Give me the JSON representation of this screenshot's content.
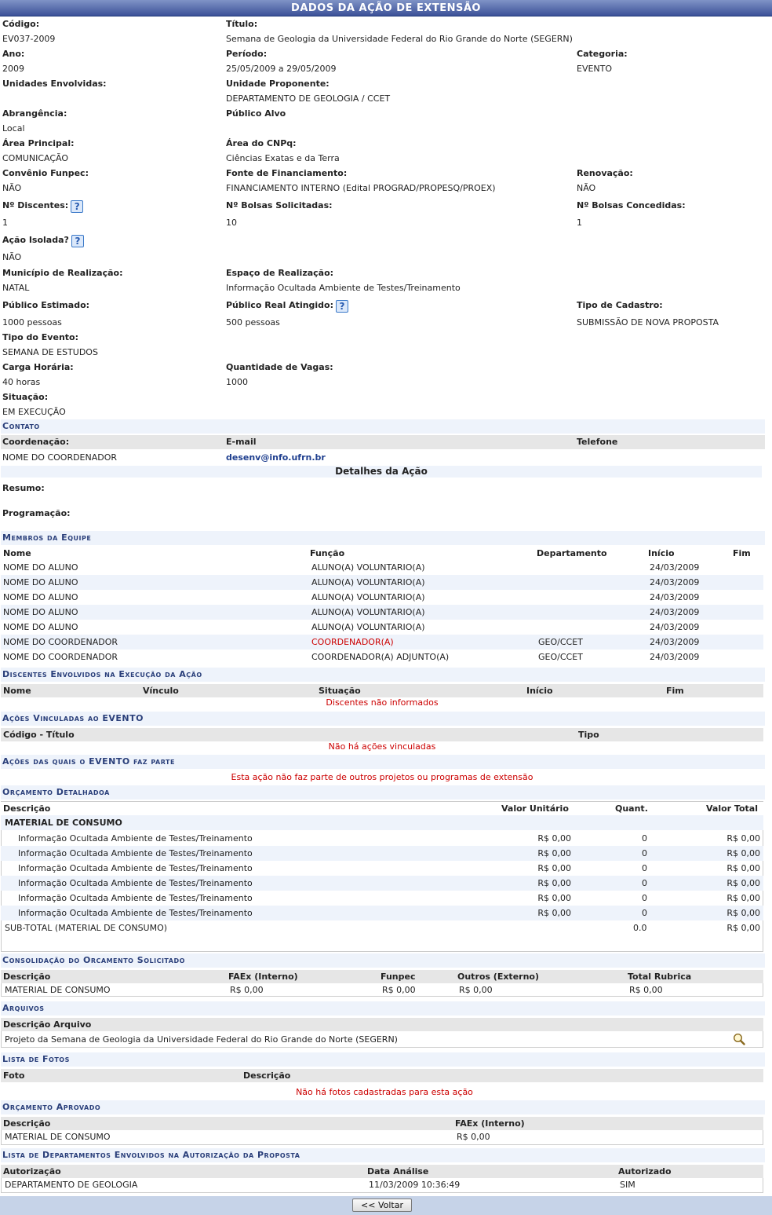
{
  "page_title": "DADOS DA AÇÃO DE EXTENSÃO",
  "fields": {
    "codigo": {
      "label": "Código:",
      "value": "EV037-2009"
    },
    "titulo": {
      "label": "Título:",
      "value": "Semana de Geologia da Universidade Federal do Rio Grande do Norte (SEGERN)"
    },
    "ano": {
      "label": "Ano:",
      "value": "2009"
    },
    "periodo": {
      "label": "Período:",
      "value": "25/05/2009 a 29/05/2009"
    },
    "categoria": {
      "label": "Categoria:",
      "value": "EVENTO"
    },
    "unidades": {
      "label": "Unidades Envolvidas:",
      "value": ""
    },
    "unidade_proponente": {
      "label": "Unidade Proponente:",
      "value": "DEPARTAMENTO DE GEOLOGIA / CCET"
    },
    "abrangencia": {
      "label": "Abrangência:",
      "value": "Local"
    },
    "publico_alvo": {
      "label": "Público Alvo",
      "value": ""
    },
    "area_principal": {
      "label": "Área Principal:",
      "value": "COMUNICAÇÃO"
    },
    "area_cnpq": {
      "label": "Área do CNPq:",
      "value": "Ciências Exatas e da Terra"
    },
    "convenio": {
      "label": "Convênio Funpec:",
      "value": "NÃO"
    },
    "fonte": {
      "label": "Fonte de Financiamento:",
      "value": "FINANCIAMENTO INTERNO (Edital PROGRAD/PROPESQ/PROEX)"
    },
    "renovacao": {
      "label": "Renovação:",
      "value": "NÃO"
    },
    "discentes": {
      "label": "Nº Discentes:",
      "value": "1"
    },
    "bolsas_sol": {
      "label": "Nº Bolsas Solicitadas:",
      "value": "10"
    },
    "bolsas_conc": {
      "label": "Nº Bolsas Concedidas:",
      "value": "1"
    },
    "acao_isolada": {
      "label": "Ação Isolada?",
      "value": "NÃO"
    },
    "municipio": {
      "label": "Município de Realização:",
      "value": "NATAL"
    },
    "espaco": {
      "label": "Espaço de Realização:",
      "value": "Informação Ocultada Ambiente de Testes/Treinamento"
    },
    "publico_est": {
      "label": "Público Estimado:",
      "value": "1000 pessoas"
    },
    "publico_real": {
      "label": "Público Real Atingido:",
      "value": "500 pessoas"
    },
    "tipo_cadastro": {
      "label": "Tipo de Cadastro:",
      "value": "SUBMISSÃO DE NOVA PROPOSTA"
    },
    "tipo_evento": {
      "label": "Tipo do Evento:",
      "value": "SEMANA DE ESTUDOS"
    },
    "carga": {
      "label": "Carga Horária:",
      "value": "40 horas"
    },
    "vagas": {
      "label": "Quantidade de Vagas:",
      "value": "1000"
    },
    "situacao": {
      "label": "Situação:",
      "value": "EM EXECUÇÃO"
    }
  },
  "contato": {
    "section": "Contato",
    "headers": [
      "Coordenação:",
      "E-mail",
      "Telefone"
    ],
    "row": [
      "NOME DO COORDENADOR",
      "desenv@info.ufrn.br",
      ""
    ],
    "detalhes": "Detalhes da Ação",
    "resumo": "Resumo:",
    "programacao": "Programação:"
  },
  "membros": {
    "section": "Membros da Equipe",
    "headers": [
      "Nome",
      "Função",
      "Departamento",
      "Início",
      "Fim"
    ],
    "rows": [
      [
        "NOME DO ALUNO",
        "ALUNO(A) VOLUNTARIO(A)",
        "",
        "24/03/2009",
        ""
      ],
      [
        "NOME DO ALUNO",
        "ALUNO(A) VOLUNTARIO(A)",
        "",
        "24/03/2009",
        ""
      ],
      [
        "NOME DO ALUNO",
        "ALUNO(A) VOLUNTARIO(A)",
        "",
        "24/03/2009",
        ""
      ],
      [
        "NOME DO ALUNO",
        "ALUNO(A) VOLUNTARIO(A)",
        "",
        "24/03/2009",
        ""
      ],
      [
        "NOME DO ALUNO",
        "ALUNO(A) VOLUNTARIO(A)",
        "",
        "24/03/2009",
        ""
      ],
      [
        "NOME DO COORDENADOR",
        "COORDENADOR(A)",
        "GEO/CCET",
        "24/03/2009",
        ""
      ],
      [
        "NOME DO COORDENADOR",
        "COORDENADOR(A) ADJUNTO(A)",
        "GEO/CCET",
        "24/03/2009",
        ""
      ]
    ]
  },
  "discentes_exec": {
    "section": "Discentes Envolvidos na Execução da Ação",
    "headers": [
      "Nome",
      "Vínculo",
      "Situação",
      "Início",
      "Fim"
    ],
    "empty": "Discentes não informados"
  },
  "acoes_vinc": {
    "section": "Ações Vinculadas ao EVENTO",
    "headers": [
      "Código - Título",
      "Tipo"
    ],
    "empty": "Não há ações vinculadas"
  },
  "acoes_parte": {
    "section": "Ações das quais o EVENTO faz parte",
    "empty": "Esta ação não faz parte de outros projetos ou programas de extensão"
  },
  "orcamento": {
    "section": "Orçamento Detalhadoa",
    "headers": [
      "Descrição",
      "Valor Unitário",
      "Quant.",
      "Valor Total"
    ],
    "group": "MATERIAL DE CONSUMO",
    "rows": [
      [
        "Informação Ocultada Ambiente de Testes/Treinamento",
        "R$ 0,00",
        "0",
        "R$ 0,00"
      ],
      [
        "Informação Ocultada Ambiente de Testes/Treinamento",
        "R$ 0,00",
        "0",
        "R$ 0,00"
      ],
      [
        "Informação Ocultada Ambiente de Testes/Treinamento",
        "R$ 0,00",
        "0",
        "R$ 0,00"
      ],
      [
        "Informação Ocultada Ambiente de Testes/Treinamento",
        "R$ 0,00",
        "0",
        "R$ 0,00"
      ],
      [
        "Informação Ocultada Ambiente de Testes/Treinamento",
        "R$ 0,00",
        "0",
        "R$ 0,00"
      ],
      [
        "Informação Ocultada Ambiente de Testes/Treinamento",
        "R$ 0,00",
        "0",
        "R$ 0,00"
      ]
    ],
    "subtotal": [
      "SUB-TOTAL (MATERIAL DE CONSUMO)",
      "0.0",
      "R$ 0,00"
    ]
  },
  "consolidacao": {
    "section": "Consolidação do Orcamento Solicitado",
    "headers": [
      "Descrição",
      "FAEx (Interno)",
      "Funpec",
      "Outros (Externo)",
      "Total Rubrica"
    ],
    "row": [
      "MATERIAL DE CONSUMO",
      "R$ 0,00",
      "R$ 0,00",
      "R$ 0,00",
      "R$ 0,00"
    ]
  },
  "arquivos": {
    "section": "Arquivos",
    "header": "Descrição Arquivo",
    "row": "Projeto da Semana de Geologia da Universidade Federal do Rio Grande do Norte (SEGERN)",
    "icon": "magnifier-icon"
  },
  "fotos": {
    "section": "Lista de Fotos",
    "headers": [
      "Foto",
      "Descrição"
    ],
    "empty": "Não há fotos cadastradas para esta ação"
  },
  "aprovado": {
    "section": "Orçamento Aprovado",
    "headers": [
      "Descrição",
      "FAEx (Interno)"
    ],
    "row": [
      "MATERIAL DE CONSUMO",
      "R$ 0,00"
    ]
  },
  "departamentos": {
    "section": "Lista de Departamentos Envolvidos na Autorização da Proposta",
    "headers": [
      "Autorização",
      "Data Análise",
      "Autorizado"
    ],
    "row": [
      "DEPARTAMENTO DE GEOLOGIA",
      "11/03/2009 10:36:49",
      "SIM"
    ]
  },
  "footer": {
    "voltar": "<< Voltar"
  },
  "colors": {
    "header_blue": "#3c5198",
    "section_bg": "#eef3fb",
    "section_text": "#2a3f7a",
    "alert_red": "#cc0000",
    "link_blue": "#1f3f8f"
  }
}
